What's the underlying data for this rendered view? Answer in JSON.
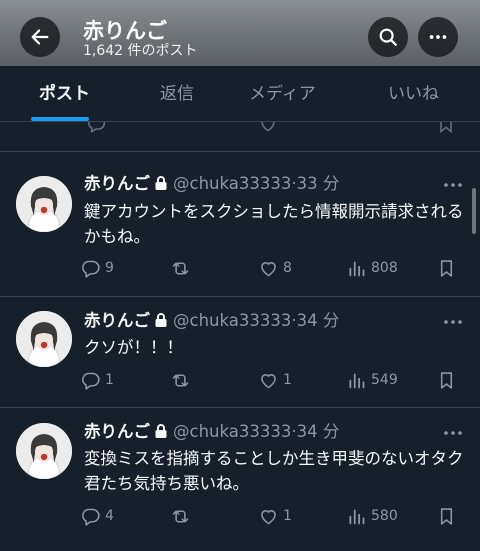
{
  "header": {
    "title": "赤りんご",
    "post_count": "1,642 件のポスト"
  },
  "tabs": [
    {
      "label": "ポスト"
    },
    {
      "label": "返信"
    },
    {
      "label": "メディア"
    },
    {
      "label": "いいね"
    }
  ],
  "posts": [
    {
      "name": "赤りんご",
      "handle": "@chuka33333",
      "separator": "·",
      "time": "33 分",
      "text": "鍵アカウントをスクショしたら情報開示請求されるかもね。",
      "replies": "9",
      "likes": "8",
      "views": "808"
    },
    {
      "name": "赤りんご",
      "handle": "@chuka33333",
      "separator": "·",
      "time": "34 分",
      "text": "クソが！！！",
      "replies": "1",
      "likes": "1",
      "views": "549"
    },
    {
      "name": "赤りんご",
      "handle": "@chuka33333",
      "separator": "·",
      "time": "34 分",
      "text": "変換ミスを指摘することしか生き甲斐のないオタク君たち気持ち悪いね。",
      "replies": "4",
      "likes": "1",
      "views": "580"
    }
  ],
  "icons": {
    "back": "arrow-left-icon",
    "search": "search-icon",
    "more": "more-horizontal-icon",
    "lock": "lock-icon",
    "reply": "reply-icon",
    "repost": "repost-icon",
    "like": "heart-icon",
    "views": "analytics-icon",
    "bookmark": "bookmark-icon"
  },
  "colors": {
    "background": "#15202b",
    "accent": "#1d9bf0",
    "muted": "#8b98a5",
    "divider": "#38444d"
  }
}
